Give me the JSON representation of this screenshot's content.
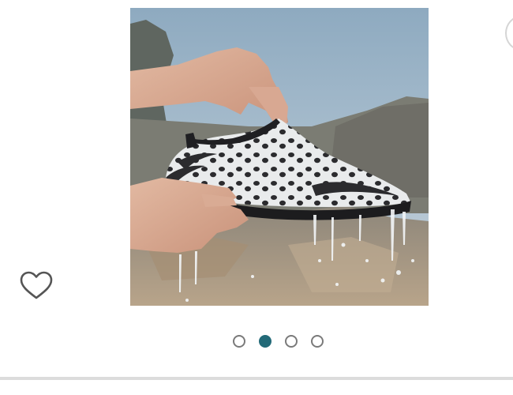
{
  "product_gallery": {
    "current_image": 2,
    "image_count": 4,
    "image_subject": "water-shoe",
    "dots": [
      {
        "index": 1,
        "active": false
      },
      {
        "index": 2,
        "active": true
      },
      {
        "index": 3,
        "active": false
      },
      {
        "index": 4,
        "active": false
      }
    ]
  },
  "wishlist": {
    "icon": "heart-outline-icon"
  },
  "colors": {
    "active_dot": "#236a78",
    "inactive_dot_border": "#7a7a7a",
    "divider": "#dcdcdc"
  }
}
